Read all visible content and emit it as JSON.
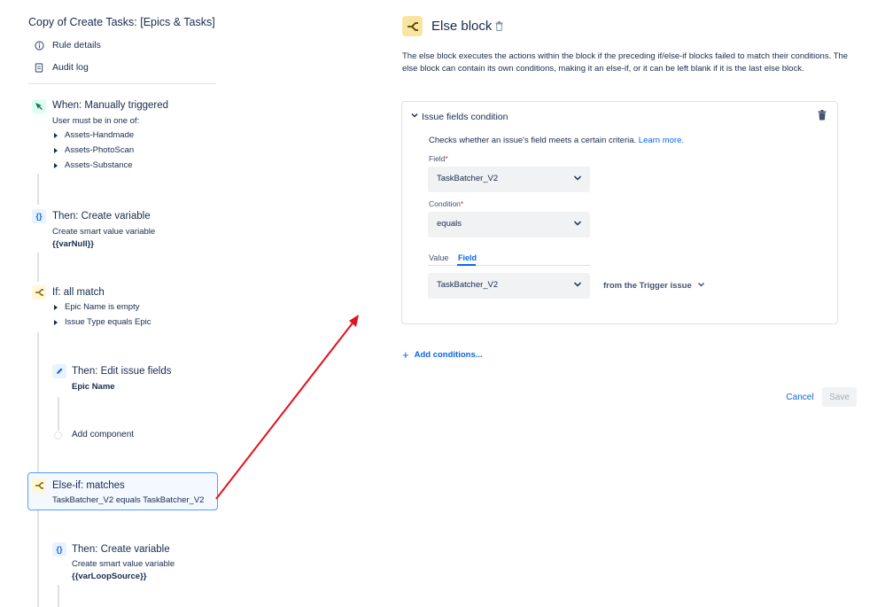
{
  "sidebar": {
    "rule_title": "Copy of Create Tasks: [Epics & Tasks]",
    "links": [
      {
        "label": "Rule details",
        "icon": "info-icon"
      },
      {
        "label": "Audit log",
        "icon": "document-icon"
      }
    ],
    "components": {
      "trigger": {
        "title": "When: Manually triggered",
        "subtitle": "User must be in one of:",
        "items": [
          "Assets-Handmade",
          "Assets-PhotoScan",
          "Assets-Substance"
        ]
      },
      "create_variable_1": {
        "title": "Then: Create variable",
        "subtitle": "Create smart value variable",
        "value": "{{varNull}}"
      },
      "if_block": {
        "title": "If: all match",
        "items": [
          "Epic Name is empty",
          "Issue Type equals Epic"
        ]
      },
      "edit_fields": {
        "title": "Then: Edit issue fields",
        "value": "Epic Name"
      },
      "add_component": "Add component",
      "else_if": {
        "title": "Else-if: matches",
        "subtitle": "TaskBatcher_V2 equals TaskBatcher_V2"
      },
      "create_variable_2": {
        "title": "Then: Create variable",
        "subtitle": "Create smart value variable",
        "value": "{{varLoopSource}}"
      }
    }
  },
  "main": {
    "title": "Else block",
    "description": "The else block executes the actions within the block if the preceding if/else-if blocks failed to match their conditions. The else block can contain its own conditions, making it an else-if, or it can be left blank if it is the last else block.",
    "condition_card": {
      "title": "Issue fields condition",
      "description": "Checks whether an issue's field meets a certain criteria.",
      "learn_more": "Learn more.",
      "field_label": "Field",
      "field_value": "TaskBatcher_V2",
      "condition_label": "Condition",
      "condition_value": "equals",
      "tabs": [
        "Value",
        "Field"
      ],
      "active_tab": "Field",
      "compare_value": "TaskBatcher_V2",
      "from_trigger": "from the Trigger issue"
    },
    "add_conditions": "Add conditions...",
    "cancel_label": "Cancel",
    "save_label": "Save"
  },
  "colors": {
    "accent": "#0c66e4",
    "annotation_arrow": "#e3121b",
    "selected_border": "#579dff",
    "required": "#c9372c"
  }
}
